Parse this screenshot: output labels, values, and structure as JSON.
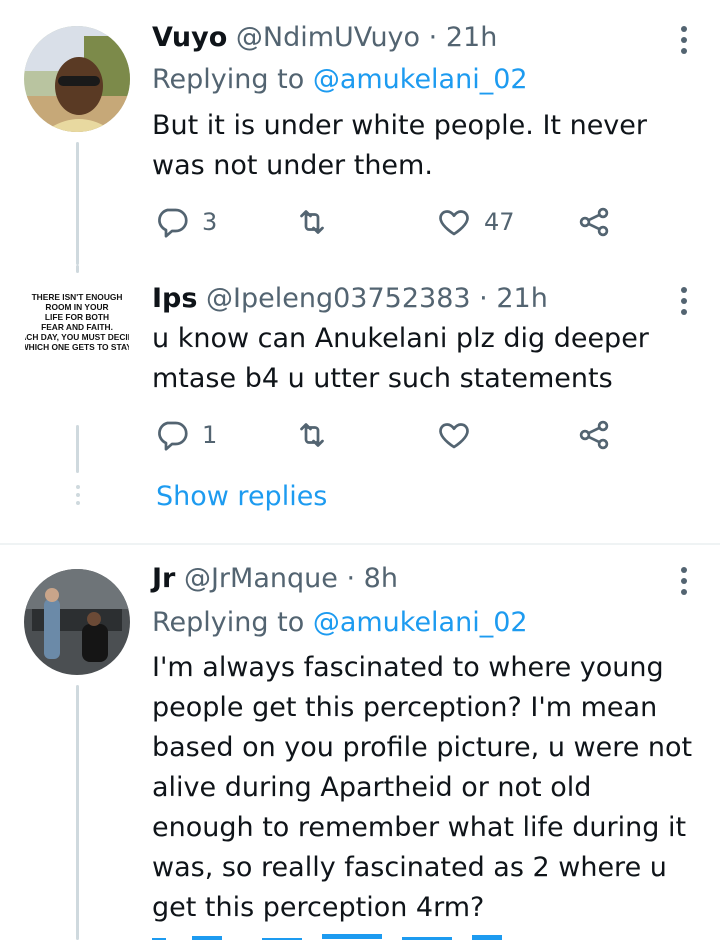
{
  "tweets": [
    {
      "name": "Vuyo",
      "handle": "@NdimUVuyo",
      "sep": "·",
      "time": "21h",
      "replying_prefix": "Replying to ",
      "replying_to": "@amukelani_02",
      "text": "But it is under white people. It never was not under them.",
      "replies": "3",
      "retweets": "",
      "likes": "47"
    },
    {
      "name": "Ips",
      "handle": "@Ipeleng03752383",
      "sep": "·",
      "time": "21h",
      "avatar_text": "THERE ISN'T ENOUGH ROOM IN YOUR LIFE FOR BOTH FEAR AND FAITH. EACH DAY, YOU MUST DECIDE WHICH ONE GETS TO STAY.",
      "text": "u know can Anukelani plz dig deeper mtase b4 u utter such statements",
      "replies": "1",
      "retweets": "",
      "likes": ""
    },
    {
      "name": "Jr",
      "handle": "@JrManque",
      "sep": "·",
      "time": "8h",
      "replying_prefix": "Replying to ",
      "replying_to": "@amukelani_02",
      "text": "I'm always fascinated to where young people get this perception? I'm mean based on you profile picture, u were not alive during Apartheid or not old enough to remember what life during it was, so really fascinated as 2 where u get this perception 4rm?"
    }
  ],
  "show_replies": "Show replies",
  "icons": {
    "reply": "reply-icon",
    "retweet": "retweet-icon",
    "like": "heart-icon",
    "share": "share-icon",
    "more": "more-vertical-icon"
  },
  "colors": {
    "accent": "#1d9bf0",
    "secondary_text": "#536471",
    "thread_line": "#cfd9de"
  }
}
